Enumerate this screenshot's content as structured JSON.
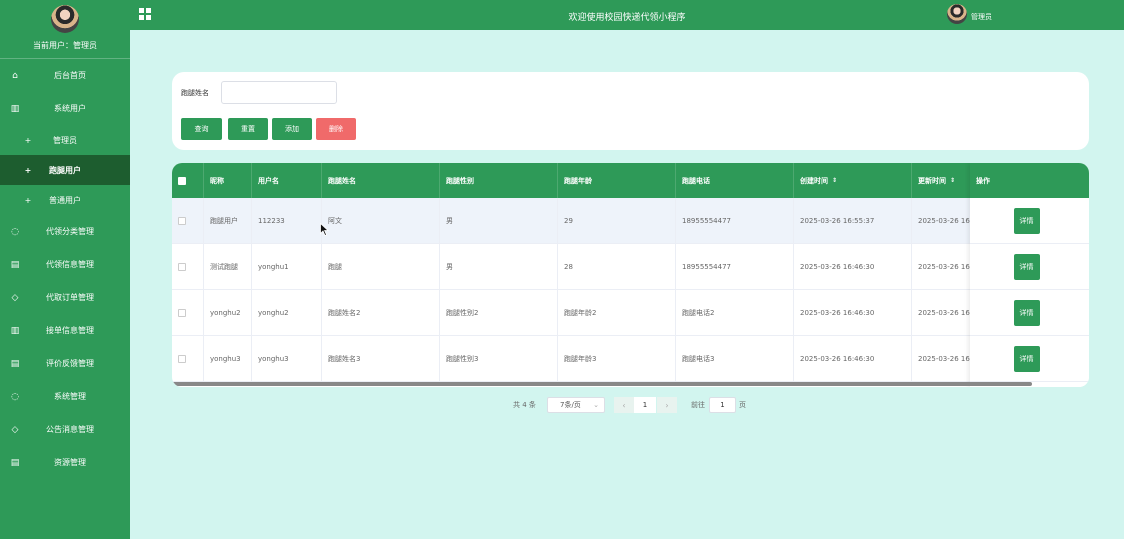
{
  "sidebar": {
    "current_user": "当前用户：管理员",
    "items": [
      {
        "label": "后台首页",
        "icon": "home-icon",
        "glyph": "⌂"
      },
      {
        "label": "系统用户",
        "icon": "columns-icon",
        "glyph": "▥"
      },
      {
        "label": "管理员",
        "icon": "plus-icon",
        "glyph": "+"
      },
      {
        "label": "跑腿用户",
        "icon": "plus-icon",
        "glyph": "+"
      },
      {
        "label": "普通用户",
        "icon": "plus-icon",
        "glyph": "+"
      },
      {
        "label": "代领分类管理",
        "icon": "chat-icon",
        "glyph": "◌"
      },
      {
        "label": "代领信息管理",
        "icon": "document-icon",
        "glyph": "▤"
      },
      {
        "label": "代取订单管理",
        "icon": "shield-icon",
        "glyph": "◇"
      },
      {
        "label": "接单信息管理",
        "icon": "columns-icon",
        "glyph": "▥"
      },
      {
        "label": "评价反馈管理",
        "icon": "document-icon",
        "glyph": "▤"
      },
      {
        "label": "系统管理",
        "icon": "chat-icon",
        "glyph": "◌"
      },
      {
        "label": "公告消息管理",
        "icon": "shield-icon",
        "glyph": "◇"
      },
      {
        "label": "资源管理",
        "icon": "document-icon",
        "glyph": "▤"
      }
    ]
  },
  "header": {
    "title": "欢迎使用校园快递代领小程序",
    "user": "管理员"
  },
  "search": {
    "label": "跑腿姓名",
    "value": "",
    "buttons": {
      "query": "查询",
      "reset": "重置",
      "add": "添加",
      "delete": "删除"
    }
  },
  "table": {
    "columns": [
      "昵称",
      "用户名",
      "跑腿姓名",
      "跑腿性别",
      "跑腿年龄",
      "跑腿电话",
      "创建时间",
      "更新时间",
      "操作"
    ],
    "rows": [
      [
        "跑腿用户",
        "112233",
        "阿文",
        "男",
        "29",
        "18955554477",
        "2025-03-26 16:55:37",
        "2025-03-26 16"
      ],
      [
        "测试跑腿",
        "yonghu1",
        "跑腿",
        "男",
        "28",
        "18955554477",
        "2025-03-26 16:46:30",
        "2025-03-26 16"
      ],
      [
        "yonghu2",
        "yonghu2",
        "跑腿姓名2",
        "跑腿性别2",
        "跑腿年龄2",
        "跑腿电话2",
        "2025-03-26 16:46:30",
        "2025-03-26 16"
      ],
      [
        "yonghu3",
        "yonghu3",
        "跑腿姓名3",
        "跑腿性别3",
        "跑腿年龄3",
        "跑腿电话3",
        "2025-03-26 16:46:30",
        "2025-03-26 16"
      ]
    ],
    "detail_label": "详情",
    "sort_icon": "⇕"
  },
  "pagination": {
    "total": "共 4 条",
    "page_size": "7条/页",
    "current_page": "1",
    "goto_label": "前往",
    "goto_value": "1",
    "page_suffix": "页"
  },
  "colors": {
    "primary": "#2e9a58",
    "active_menu": "#1d5d2f",
    "background": "#d2f5ef",
    "danger": "#f06a6a"
  }
}
